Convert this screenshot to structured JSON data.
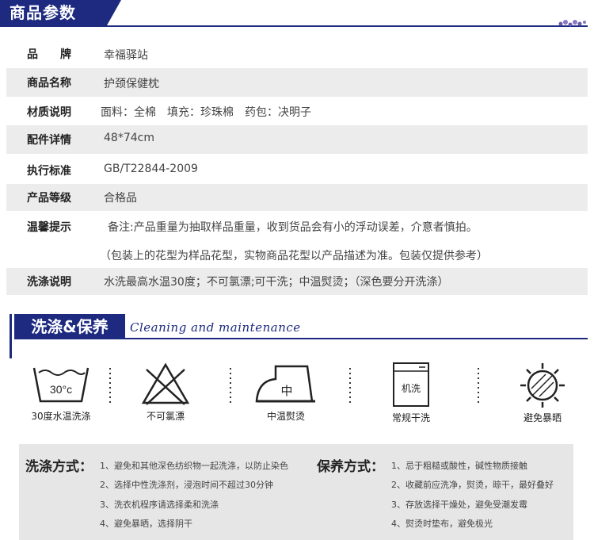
{
  "header": {
    "title": "商品参数"
  },
  "specs": [
    {
      "label": "品　　牌",
      "value": "幸福驿站"
    },
    {
      "label": "商品名称",
      "value": "护颈保健枕"
    },
    {
      "label": "材质说明",
      "value": "面料：全棉　填充：珍珠棉　药包：决明子"
    },
    {
      "label": "配件详情",
      "value": "48*74cm"
    },
    {
      "label": "执行标准",
      "value": "GB/T22844-2009"
    },
    {
      "label": "产品等级",
      "value": "合格品"
    },
    {
      "label": "温馨提示",
      "value": "备注:产品重量为抽取样品重量，收到货品会有小的浮动误差，介意者慎拍。",
      "value2": "（包装上的花型为样品花型，实物商品花型以产品描述为准。包装仅提供参考）"
    },
    {
      "label": "洗涤说明",
      "value": "水洗最高水温30度；不可氯漂;可干洗；中温熨烫；（深色要分开洗涤）"
    }
  ],
  "section": {
    "title": "洗涤&保养",
    "subtitle": "Cleaning and maintenance"
  },
  "care_icons": [
    {
      "icon": "wash-30-icon",
      "inner": "30°c",
      "caption": "30度水温洗涤"
    },
    {
      "icon": "no-bleach-icon",
      "inner": "",
      "caption": "不可氯漂"
    },
    {
      "icon": "iron-medium-icon",
      "inner": "中",
      "caption": "中温熨烫"
    },
    {
      "icon": "machine-dry-icon",
      "inner": "机洗",
      "caption": "常规干洗"
    },
    {
      "icon": "avoid-sun-icon",
      "inner": "",
      "caption": "避免暴晒"
    }
  ],
  "panel": {
    "wash": {
      "title": "洗涤方式：",
      "items": [
        "1、避免和其他深色纺织物一起洗涤，以防止染色",
        "2、选择中性洗涤剂，浸泡时间不超过30分钟",
        "3、洗衣机程序请选择柔和洗涤",
        "4、避免暴晒，选择阴干"
      ]
    },
    "care": {
      "title": "保养方式：",
      "items": [
        "1、忌于粗糙或酸性，碱性物质接触",
        "2、收藏前应洗净，熨烫，晾干，最好叠好",
        "3、存放选择干燥处，避免受潮发霉",
        "4、熨烫时垫布，避免极光"
      ]
    }
  }
}
